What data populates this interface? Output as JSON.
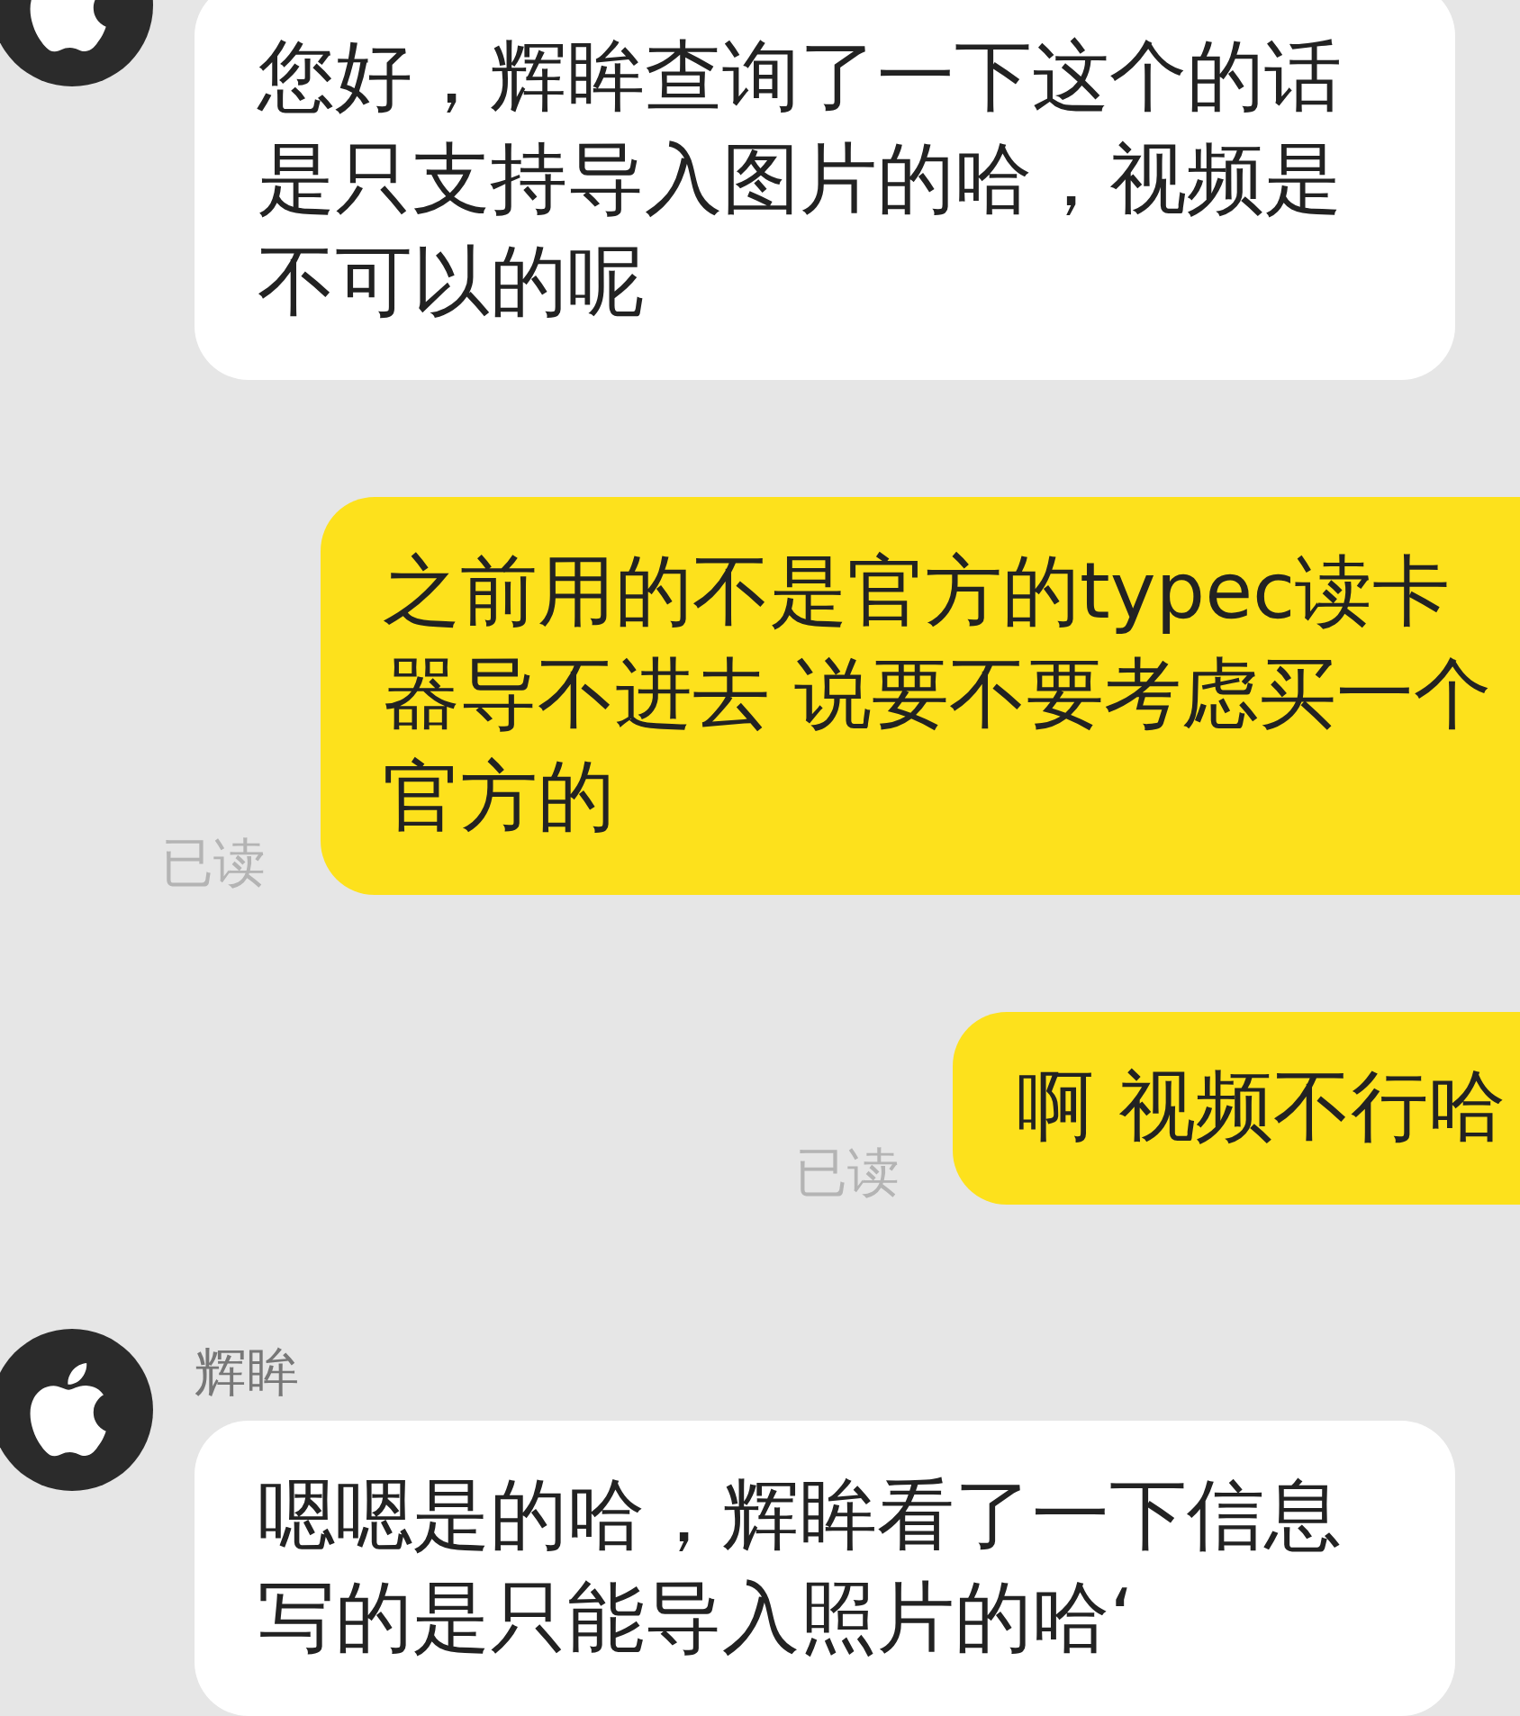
{
  "messages": [
    {
      "kind": "incoming",
      "text": "您好，辉眸查询了一下这个的话是只支持导入图片的哈，视频是不可以的呢"
    },
    {
      "kind": "outgoing",
      "text": "之前用的不是官方的typec读卡器导不进去 说要不要考虑买一个官方的",
      "status": "已读"
    },
    {
      "kind": "outgoing",
      "text": "啊 视频不行哈",
      "status": "已读"
    },
    {
      "kind": "incoming",
      "sender": "辉眸",
      "text": "嗯嗯是的哈，辉眸看了一下信息写的是只能导入照片的哈‘"
    }
  ]
}
